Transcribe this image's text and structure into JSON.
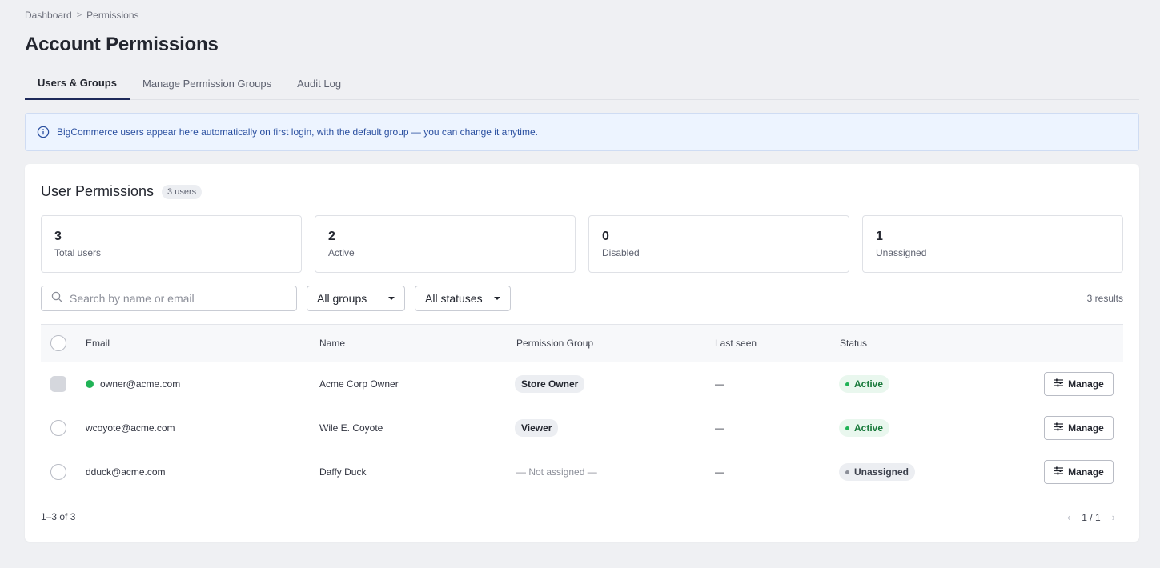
{
  "breadcrumb": {
    "items": [
      "Dashboard",
      "Permissions"
    ],
    "separator": ">"
  },
  "page": {
    "title": "Account Permissions"
  },
  "tabs": [
    {
      "label": "Users & Groups",
      "active": true
    },
    {
      "label": "Manage Permission Groups",
      "active": false
    },
    {
      "label": "Audit Log",
      "active": false
    }
  ],
  "banner": {
    "icon": "info-icon",
    "text": "BigCommerce users appear here automatically on first login, with the default group — you can change it anytime."
  },
  "panel": {
    "title": "User Permissions",
    "badge": "3 users"
  },
  "stats": [
    {
      "value": "3",
      "label": "Total users"
    },
    {
      "value": "2",
      "label": "Active"
    },
    {
      "value": "0",
      "label": "Disabled"
    },
    {
      "value": "1",
      "label": "Unassigned"
    }
  ],
  "toolbar": {
    "search_placeholder": "Search by name or email",
    "groups_filter": "All groups",
    "status_filter": "All statuses",
    "results": "3 results"
  },
  "table": {
    "columns": [
      "Email",
      "Name",
      "Permission Group",
      "Last seen",
      "Status"
    ],
    "rows": [
      {
        "email": "owner@acme.com",
        "online": true,
        "name": "Acme Corp Owner",
        "group": "Store Owner",
        "last_seen": "—",
        "status": "Active",
        "manage": "Manage"
      },
      {
        "email": "wcoyote@acme.com",
        "online": false,
        "name": "Wile E. Coyote",
        "group": "Viewer",
        "last_seen": "—",
        "status": "Active",
        "manage": "Manage"
      },
      {
        "email": "dduck@acme.com",
        "online": false,
        "name": "Daffy Duck",
        "group": "— Not assigned —",
        "last_seen": "—",
        "status": "Unassigned",
        "manage": "Manage"
      }
    ]
  },
  "footer": {
    "range": "1–3 of 3",
    "page": "1 / 1",
    "prev": "‹",
    "next": "›"
  },
  "colors": {
    "accent": "#1e2a5a",
    "active_green": "#20b356",
    "banner_bg": "#edf4ff",
    "page_bg": "#eff0f3"
  }
}
